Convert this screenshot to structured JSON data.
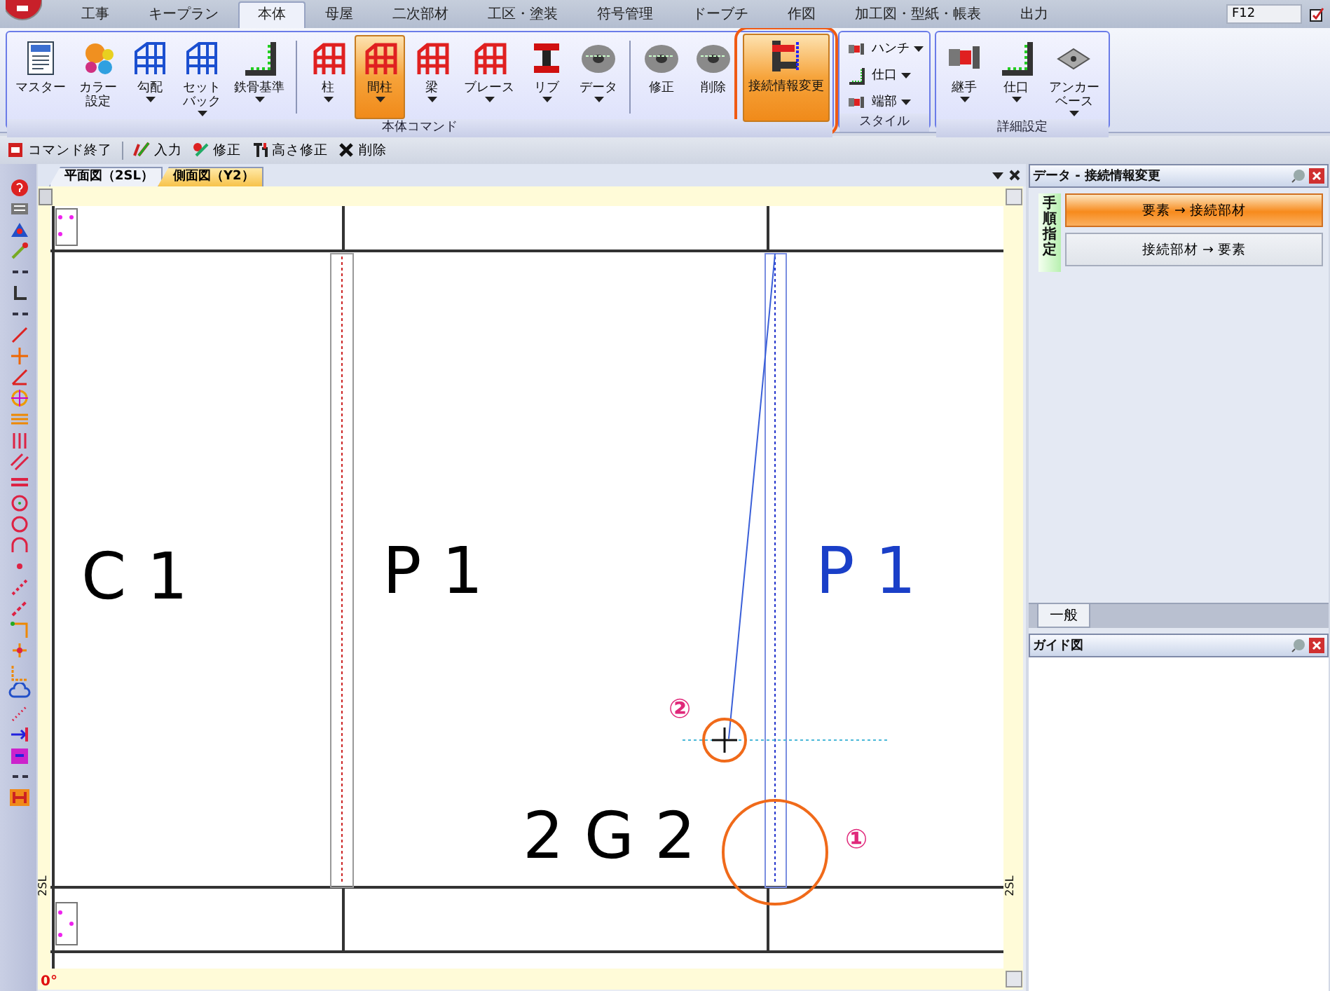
{
  "app_tabs": [
    {
      "label": "工事",
      "selected": false
    },
    {
      "label": "キープラン",
      "selected": false
    },
    {
      "label": "本体",
      "selected": true
    },
    {
      "label": "母屋",
      "selected": false
    },
    {
      "label": "二次部材",
      "selected": false
    },
    {
      "label": "工区・塗装",
      "selected": false
    },
    {
      "label": "符号管理",
      "selected": false
    },
    {
      "label": "ドーブチ",
      "selected": false
    },
    {
      "label": "作図",
      "selected": false
    },
    {
      "label": "加工図・型紙・帳表",
      "selected": false
    },
    {
      "label": "出力",
      "selected": false
    }
  ],
  "shortcut_field": {
    "value": "F12"
  },
  "ribbon": {
    "groups": [
      {
        "title": "本体コマンド",
        "items": [
          {
            "kind": "large",
            "label": "マスター",
            "menu": false,
            "selected": false,
            "callout": false
          },
          {
            "kind": "large",
            "label": "カラー設定",
            "menu": false,
            "selected": false,
            "callout": false
          },
          {
            "kind": "large",
            "label": "勾配",
            "menu": true,
            "selected": false,
            "callout": false
          },
          {
            "kind": "large",
            "label": "セットバック",
            "menu": true,
            "selected": false,
            "callout": false
          },
          {
            "kind": "large",
            "label": "鉄骨基準",
            "menu": true,
            "selected": false,
            "callout": false
          },
          {
            "kind": "separator"
          },
          {
            "kind": "large",
            "label": "柱",
            "menu": true,
            "selected": false,
            "callout": false
          },
          {
            "kind": "large",
            "label": "間柱",
            "menu": true,
            "selected": true,
            "callout": false
          },
          {
            "kind": "large",
            "label": "梁",
            "menu": true,
            "selected": false,
            "callout": false
          },
          {
            "kind": "large",
            "label": "ブレース",
            "menu": true,
            "selected": false,
            "callout": false
          },
          {
            "kind": "large",
            "label": "リブ",
            "menu": true,
            "selected": false,
            "callout": false
          },
          {
            "kind": "large",
            "label": "データ",
            "menu": true,
            "selected": false,
            "callout": false
          },
          {
            "kind": "separator"
          },
          {
            "kind": "large",
            "label": "修正",
            "menu": false,
            "selected": false,
            "callout": false
          },
          {
            "kind": "large",
            "label": "削除",
            "menu": false,
            "selected": false,
            "callout": false
          },
          {
            "kind": "large",
            "label": "接続情報変更",
            "menu": false,
            "selected": true,
            "callout": true
          }
        ]
      },
      {
        "title": "スタイル",
        "items": [
          {
            "kind": "small",
            "label": "ハンチ",
            "menu": true,
            "selected": false,
            "callout": false
          },
          {
            "kind": "small",
            "label": "仕口",
            "menu": true,
            "selected": false,
            "callout": false
          },
          {
            "kind": "small",
            "label": "端部",
            "menu": true,
            "selected": false,
            "callout": false
          }
        ]
      },
      {
        "title": "詳細設定",
        "items": [
          {
            "kind": "large",
            "label": "継手",
            "menu": true,
            "selected": false,
            "callout": false
          },
          {
            "kind": "large",
            "label": "仕口",
            "menu": true,
            "selected": false,
            "callout": false
          },
          {
            "kind": "large",
            "label": "アンカーベース",
            "menu": true,
            "selected": false,
            "callout": false
          }
        ]
      }
    ]
  },
  "command_bar": [
    {
      "kind": "command",
      "label": "コマンド終了"
    },
    {
      "kind": "separator"
    },
    {
      "kind": "command",
      "label": "入力"
    },
    {
      "kind": "command",
      "label": "修正"
    },
    {
      "kind": "command",
      "label": "高さ修正"
    },
    {
      "kind": "command",
      "label": "削除"
    }
  ],
  "doc_tabs": [
    {
      "label": "平面図（2SL）",
      "selected": false
    },
    {
      "label": "側面図（Y2）",
      "selected": true
    }
  ],
  "canvas": {
    "labels": [
      {
        "text": "C 1",
        "color": "#000000"
      },
      {
        "text": "P 1",
        "color": "#000000"
      },
      {
        "text": "P 1",
        "color": "#1a3fc8"
      },
      {
        "text": "2 G 2",
        "color": "#000000"
      }
    ],
    "markers": [
      {
        "text": "②"
      },
      {
        "text": "①"
      }
    ],
    "ruler_labels": [
      "2SL",
      "2SL"
    ],
    "angle": "0°"
  },
  "data_panel": {
    "title": "データ - 接続情報変更",
    "step_label": "手順指定",
    "options": [
      {
        "label": "要素 → 接続部材",
        "selected": true
      },
      {
        "label": "接続部材 → 要素",
        "selected": false
      }
    ],
    "tabs": [
      {
        "label": "一般",
        "selected": true
      }
    ]
  },
  "guide_panel": {
    "title": "ガイド図"
  }
}
